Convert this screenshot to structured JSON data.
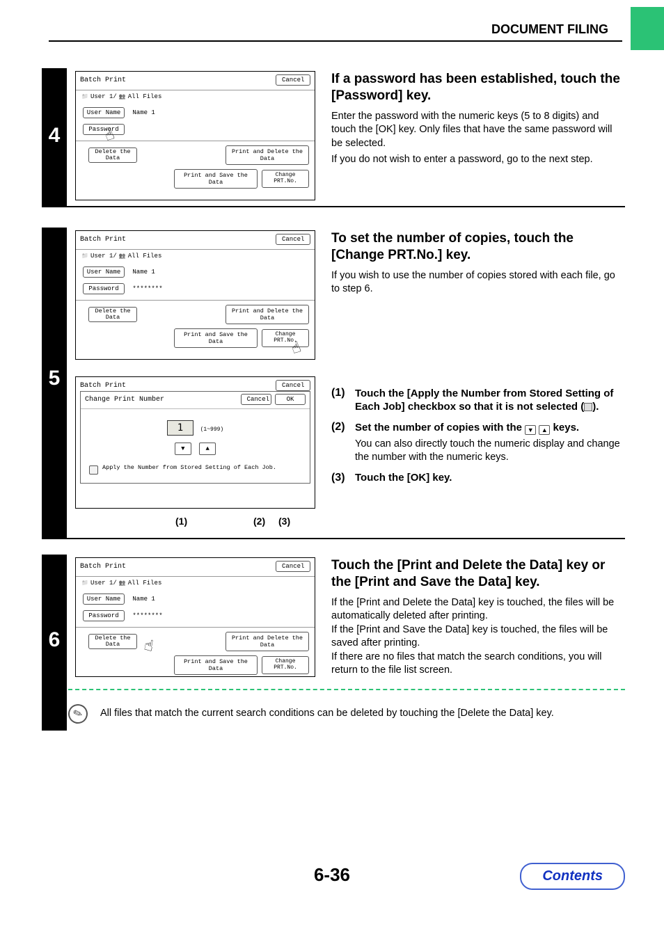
{
  "header": {
    "section": "DOCUMENT FILING"
  },
  "steps": {
    "s4": {
      "num": "4",
      "heading": "If a password has been established, touch the [Password] key.",
      "body1": "Enter the password with the numeric keys (5 to 8 digits) and touch the [OK] key. Only files that have the same password will be selected.",
      "body2": "If you do not wish to enter a password, go to the next step.",
      "panel": {
        "title": "Batch Print",
        "cancel": "Cancel",
        "crumb1": "User 1/",
        "crumb2": "All Files",
        "userNameLabel": "User Name",
        "userNameValue": "Name 1",
        "passwordLabel": "Password",
        "passwordValue": "",
        "deleteData": "Delete the\nData",
        "printDelete": "Print and Delete the Data",
        "printSave": "Print and Save the Data",
        "changePrt": "Change PRT.No."
      }
    },
    "s5": {
      "num": "5",
      "heading": "To set the number of copies, touch the [Change PRT.No.] key.",
      "body1": "If you wish to use the number of copies stored with each file, go to step 6.",
      "panelA": {
        "title": "Batch Print",
        "cancel": "Cancel",
        "crumb1": "User 1/",
        "crumb2": "All Files",
        "userNameLabel": "User Name",
        "userNameValue": "Name 1",
        "passwordLabel": "Password",
        "passwordValue": "********",
        "deleteData": "Delete the\nData",
        "printDelete": "Print and Delete the Data",
        "printSave": "Print and Save the Data",
        "changePrt": "Change PRT.No."
      },
      "panelB": {
        "outerTitle": "Batch Print",
        "outerCancel": "Cancel",
        "title": "Change Print Number",
        "cancel": "Cancel",
        "ok": "OK",
        "copies": "1",
        "range": "(1~999)",
        "applyText": "Apply the Number from Stored Setting of Each Job."
      },
      "callouts": {
        "c1": "(1)",
        "c2": "(2)",
        "c3": "(3)"
      },
      "list": {
        "i1num": "(1)",
        "i1txt": "Touch the [Apply the Number from Stored Setting of Each Job] checkbox so that it is not selected (",
        "i1txt2": ").",
        "i2num": "(2)",
        "i2txt": "Set the number of copies with the ",
        "i2txt2": " keys.",
        "i2sub": "You can also directly touch the numeric display and change the number with the numeric keys.",
        "i3num": "(3)",
        "i3txt": "Touch the [OK] key."
      }
    },
    "s6": {
      "num": "6",
      "heading": "Touch the [Print and Delete the Data] key or the [Print and Save the Data] key.",
      "body1": "If the [Print and Delete the Data] key is touched, the files will be automatically deleted after printing.",
      "body2": "If the [Print and Save the Data] key is touched, the files will be saved after printing.",
      "body3": "If there are no files that match the search conditions, you will return to the file list screen.",
      "panel": {
        "title": "Batch Print",
        "cancel": "Cancel",
        "crumb1": "User 1/",
        "crumb2": "All Files",
        "userNameLabel": "User Name",
        "userNameValue": "Name 1",
        "passwordLabel": "Password",
        "passwordValue": "********",
        "deleteData": "Delete the\nData",
        "printDelete": "Print and Delete the Data",
        "printSave": "Print and Save the Data",
        "changePrt": "Change PRT.No."
      }
    }
  },
  "note": {
    "text": "All files that match the current search conditions can be deleted by touching the [Delete the Data] key."
  },
  "footer": {
    "pageNum": "6-36",
    "contents": "Contents"
  }
}
